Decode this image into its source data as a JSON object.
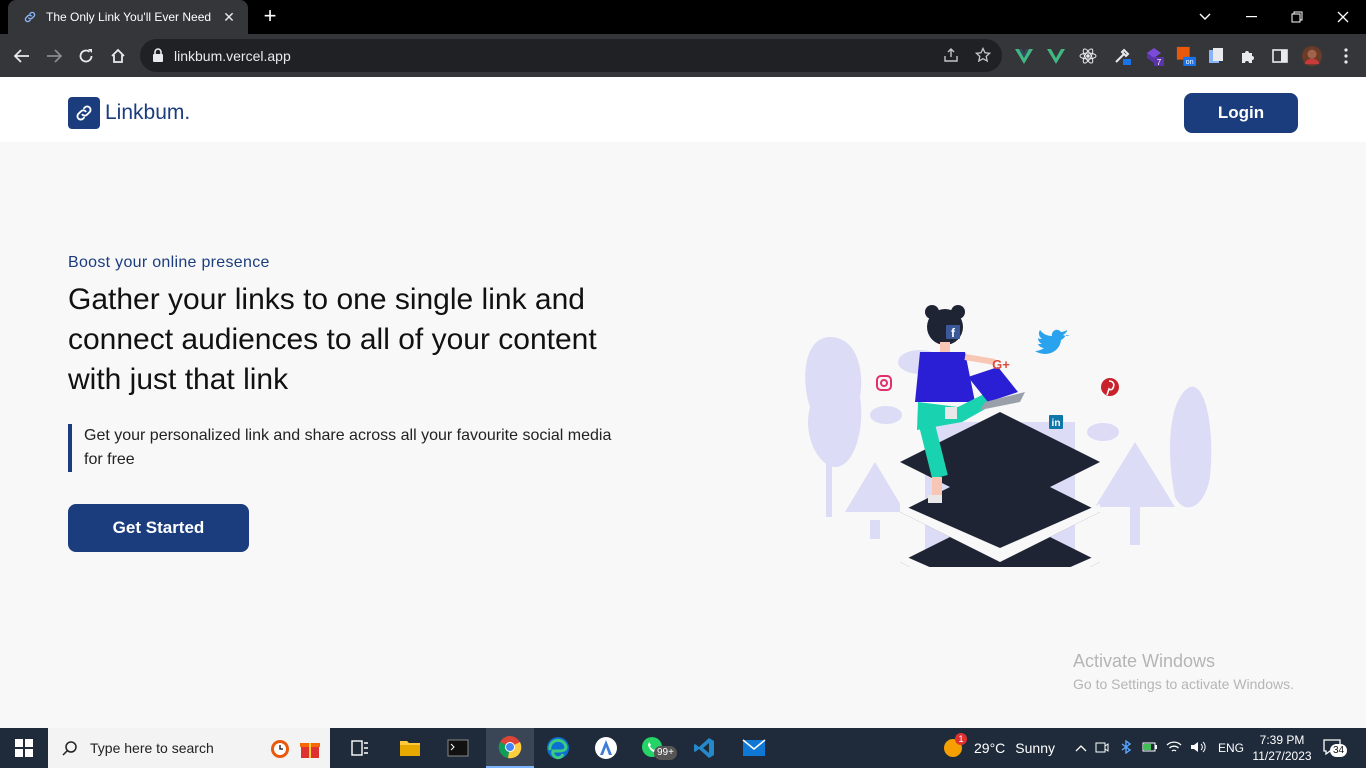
{
  "browser": {
    "tab_title": "The Only Link You'll Ever Need ||",
    "url": "linkbum.vercel.app"
  },
  "site": {
    "logo_text": "Linkbum.",
    "login_label": "Login",
    "eyebrow": "Boost your online presence",
    "headline": "Gather your links to one single link and connect audiences to all of your content with just that link",
    "subtext": "Get your personalized link and share across all your favourite social media for free",
    "cta_label": "Get Started",
    "brand_color": "#1b3d7e"
  },
  "illustration": {
    "social_icons": [
      "facebook-icon",
      "google-plus-icon",
      "twitter-icon",
      "instagram-icon",
      "pinterest-icon",
      "linkedin-icon"
    ],
    "google_plus_text": "G+",
    "linkedin_text": "in",
    "facebook_text": "f"
  },
  "watermark": {
    "line1": "Activate Windows",
    "line2": "Go to Settings to activate Windows."
  },
  "taskbar": {
    "search_placeholder": "Type here to search",
    "whatsapp_badge": "99+",
    "weather_temp": "29°C",
    "weather_text": "Sunny",
    "weather_badge": "1",
    "language": "ENG",
    "time": "7:39 PM",
    "date": "11/27/2023",
    "notification_count": "34"
  },
  "extensions": {
    "badge_7": "7",
    "badge_on": "on"
  }
}
